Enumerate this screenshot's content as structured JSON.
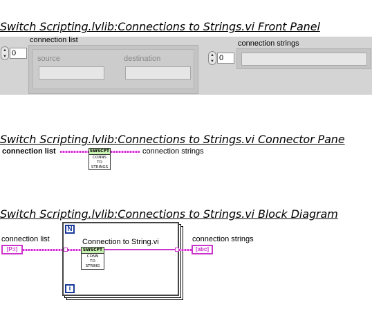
{
  "front_panel": {
    "heading": "Switch Scripting.lvlib:Connections to Strings.vi Front Panel",
    "connection_list": {
      "label": "connection list",
      "index": "0",
      "source_label": "source",
      "destination_label": "destination"
    },
    "connection_strings": {
      "label": "connection strings",
      "index": "0"
    }
  },
  "connector_pane": {
    "heading": "Switch Scripting.lvlib:Connections to Strings.vi Connector Pane",
    "input_label": "connection list",
    "output_label": "connection strings",
    "icon_top": "SWSCPT",
    "icon_lines": [
      "CONNS",
      "TO",
      "STRINGS"
    ]
  },
  "block_diagram": {
    "heading": "Switch Scripting.lvlib:Connections to Strings.vi Block Diagram",
    "input_label": "connection list",
    "input_terminal": "[P:i]",
    "output_label": "connection strings",
    "output_terminal": "[abc]",
    "loop_count": "N",
    "loop_iteration": "i",
    "subvi_label": "Connection to String.vi",
    "subvi_icon_top": "SWSCPT",
    "subvi_icon_lines": [
      "CONN",
      "TO",
      "STRING"
    ]
  },
  "colors": {
    "string_wire": "#cc33cc",
    "icon_band": "#c8f0b0",
    "loop_tag": "#1a3a9a"
  }
}
